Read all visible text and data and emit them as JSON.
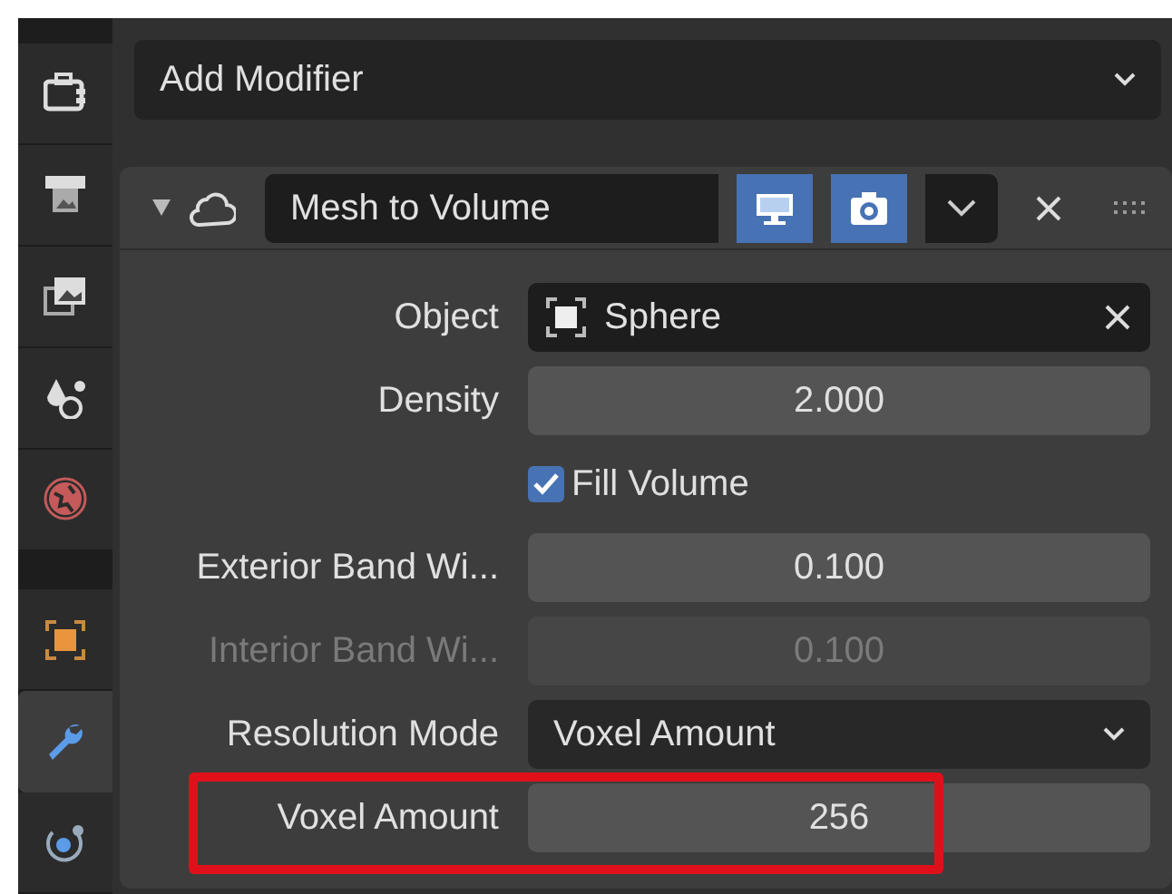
{
  "sidebar": {
    "tabs": [
      {
        "kind": "tool",
        "selected": false
      },
      {
        "kind": "render",
        "selected": false
      },
      {
        "kind": "output",
        "selected": false
      },
      {
        "kind": "view-layer",
        "selected": false
      },
      {
        "kind": "scene",
        "selected": false
      },
      {
        "kind": "object",
        "selected": false
      },
      {
        "kind": "modifier",
        "selected": true
      },
      {
        "kind": "particles",
        "selected": false
      }
    ]
  },
  "add_modifier": {
    "label": "Add Modifier"
  },
  "modifier": {
    "expanded": true,
    "name": "Mesh to Volume",
    "show_viewport": true,
    "show_render": true,
    "properties": [
      {
        "kind": "object",
        "label": "Object",
        "value": "Sphere",
        "disabled": false,
        "highlighted": false
      },
      {
        "kind": "number",
        "label": "Density",
        "value": "2.000",
        "disabled": false,
        "highlighted": false
      },
      {
        "kind": "checkbox",
        "label": "Fill Volume",
        "checked": true,
        "disabled": false,
        "highlighted": false
      },
      {
        "kind": "number",
        "label": "Exterior Band Wi...",
        "value": "0.100",
        "disabled": false,
        "highlighted": false
      },
      {
        "kind": "number",
        "label": "Interior Band Wi...",
        "value": "0.100",
        "disabled": true,
        "highlighted": false
      },
      {
        "kind": "dropdown",
        "label": "Resolution Mode",
        "value": "Voxel Amount",
        "disabled": false,
        "highlighted": false
      },
      {
        "kind": "number",
        "label": "Voxel Amount",
        "value": "256",
        "disabled": false,
        "highlighted": true
      }
    ]
  }
}
